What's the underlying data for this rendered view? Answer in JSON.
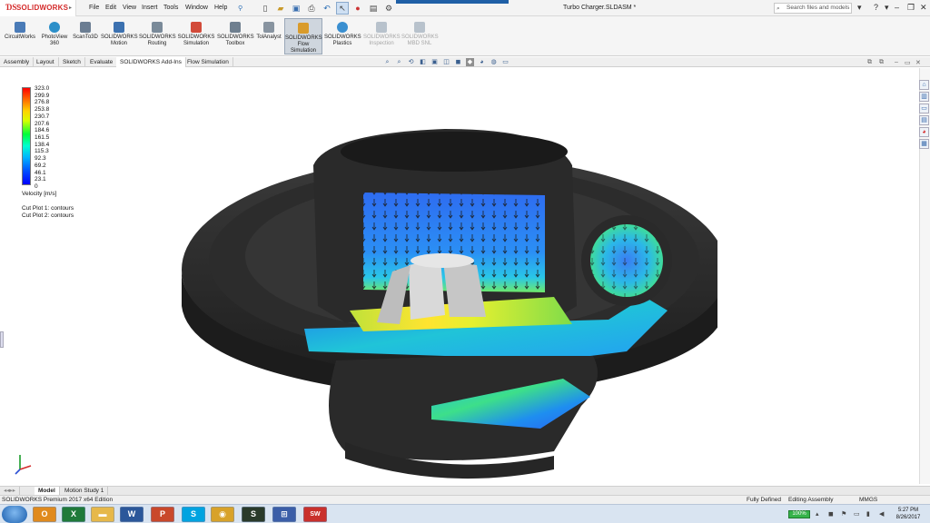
{
  "app": {
    "brand": "SOLIDWORKS",
    "document_title": "Turbo Charger.SLDASM *"
  },
  "menu": [
    "File",
    "Edit",
    "View",
    "Insert",
    "Tools",
    "Window",
    "Help"
  ],
  "search": {
    "placeholder": "Search files and models"
  },
  "commands": [
    {
      "label": "CircuitWorks",
      "icon": "circuitworks-icon",
      "color": "#4a7bb7"
    },
    {
      "label": "PhotoView 360",
      "icon": "photoview-icon",
      "color": "#2c8fc9"
    },
    {
      "label": "ScanTo3D",
      "icon": "scan-icon",
      "color": "#6b7d92"
    },
    {
      "label": "SOLIDWORKS Motion",
      "icon": "motion-icon",
      "color": "#3c71b0"
    },
    {
      "label": "SOLIDWORKS Routing",
      "icon": "routing-icon",
      "color": "#7a8a99"
    },
    {
      "label": "SOLIDWORKS Simulation",
      "icon": "simulation-icon",
      "color": "#d24b3a"
    },
    {
      "label": "SOLIDWORKS Toolbox",
      "icon": "toolbox-icon",
      "color": "#6f7f8f"
    },
    {
      "label": "TolAnalyst",
      "icon": "tolanalyst-icon",
      "color": "#8894a0"
    },
    {
      "label": "SOLIDWORKS Flow Simulation",
      "icon": "flow-icon",
      "color": "#d99b2b"
    },
    {
      "label": "SOLIDWORKS Plastics",
      "icon": "plastics-icon",
      "color": "#3a8fd0"
    },
    {
      "label": "SOLIDWORKS Inspection",
      "icon": "inspection-icon",
      "color": "#b8c2cc"
    },
    {
      "label": "SOLIDWORKS MBD SNL",
      "icon": "mbd-icon",
      "color": "#b8c2cc"
    }
  ],
  "tabs": [
    "Assembly",
    "Layout",
    "Sketch",
    "Evaluate",
    "SOLIDWORKS Add-Ins",
    "Flow Simulation"
  ],
  "legend": {
    "values": [
      "323.0",
      "299.9",
      "276.8",
      "253.8",
      "230.7",
      "207.6",
      "184.6",
      "161.5",
      "138.4",
      "115.3",
      "92.3",
      "69.2",
      "46.1",
      "23.1",
      "0"
    ],
    "unit_label": "Velocity [m/s]",
    "plots": [
      "Cut Plot 1: contours",
      "Cut Plot 2: contours"
    ]
  },
  "bottom_tabs": [
    "Model",
    "Motion Study 1"
  ],
  "status": {
    "edition": "SOLIDWORKS Premium 2017 x64 Edition",
    "definition": "Fully Defined",
    "mode": "Editing Assembly",
    "units": "MMGS"
  },
  "taskbar": {
    "apps": [
      {
        "icon": "outlook-icon",
        "glyph": "O",
        "color": "#e08a1e"
      },
      {
        "icon": "excel-icon",
        "glyph": "X",
        "color": "#1f7a3a"
      },
      {
        "icon": "folder-icon",
        "glyph": "▬",
        "color": "#e6b84a"
      },
      {
        "icon": "word-icon",
        "glyph": "W",
        "color": "#2b579a"
      },
      {
        "icon": "powerpoint-icon",
        "glyph": "P",
        "color": "#c9482b"
      },
      {
        "icon": "skype-icon",
        "glyph": "S",
        "color": "#00a3e0"
      },
      {
        "icon": "chrome-icon",
        "glyph": "◉",
        "color": "#d8a22a"
      },
      {
        "icon": "app-s-icon",
        "glyph": "S",
        "color": "#2a3a2a"
      },
      {
        "icon": "network-app-icon",
        "glyph": "⊞",
        "color": "#3b5ea8"
      },
      {
        "icon": "solidworks-icon",
        "glyph": "SW",
        "color": "#c9302c"
      }
    ],
    "battery": "100%",
    "time": "5:27 PM",
    "date": "8/26/2017"
  },
  "colors": {
    "brand_red": "#d42a2a",
    "turbo_body": "#2a2a2a",
    "accent_blue": "#1f5fa6"
  }
}
